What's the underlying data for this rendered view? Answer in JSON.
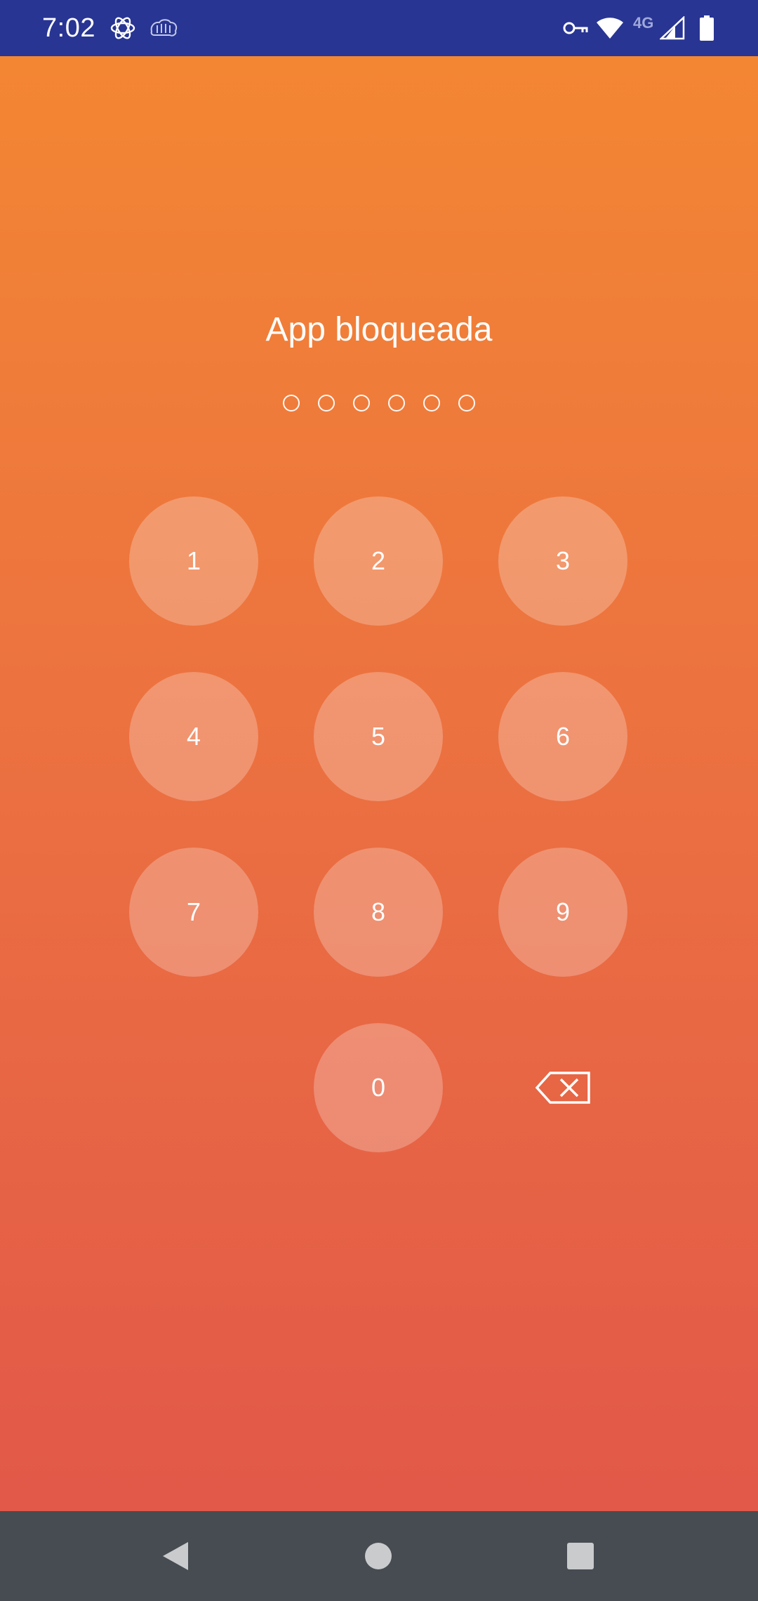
{
  "status_bar": {
    "time": "7:02",
    "network_label": "4G",
    "icons": [
      "openai-icon",
      "brain-icon",
      "vpn-key-icon",
      "wifi-icon",
      "cell-signal-icon",
      "battery-icon"
    ]
  },
  "lock": {
    "title": "App bloqueada",
    "pin_length": 6,
    "keys": [
      "1",
      "2",
      "3",
      "4",
      "5",
      "6",
      "7",
      "8",
      "9",
      "0"
    ],
    "backspace_icon": "backspace-icon"
  },
  "nav_bar": {
    "icons": [
      "back-icon",
      "home-icon",
      "recents-icon"
    ]
  },
  "colors": {
    "status_bar": "#283593",
    "gradient_top": "#f38633",
    "gradient_bottom": "#e25849",
    "nav_bar": "#474c52"
  }
}
